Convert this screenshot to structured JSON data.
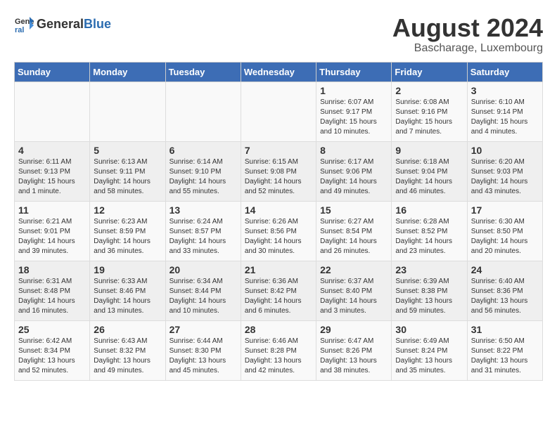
{
  "logo": {
    "text_general": "General",
    "text_blue": "Blue"
  },
  "title": "August 2024",
  "subtitle": "Bascharage, Luxembourg",
  "days_of_week": [
    "Sunday",
    "Monday",
    "Tuesday",
    "Wednesday",
    "Thursday",
    "Friday",
    "Saturday"
  ],
  "weeks": [
    [
      {
        "day": "",
        "info": ""
      },
      {
        "day": "",
        "info": ""
      },
      {
        "day": "",
        "info": ""
      },
      {
        "day": "",
        "info": ""
      },
      {
        "day": "1",
        "info": "Sunrise: 6:07 AM\nSunset: 9:17 PM\nDaylight: 15 hours\nand 10 minutes."
      },
      {
        "day": "2",
        "info": "Sunrise: 6:08 AM\nSunset: 9:16 PM\nDaylight: 15 hours\nand 7 minutes."
      },
      {
        "day": "3",
        "info": "Sunrise: 6:10 AM\nSunset: 9:14 PM\nDaylight: 15 hours\nand 4 minutes."
      }
    ],
    [
      {
        "day": "4",
        "info": "Sunrise: 6:11 AM\nSunset: 9:13 PM\nDaylight: 15 hours\nand 1 minute."
      },
      {
        "day": "5",
        "info": "Sunrise: 6:13 AM\nSunset: 9:11 PM\nDaylight: 14 hours\nand 58 minutes."
      },
      {
        "day": "6",
        "info": "Sunrise: 6:14 AM\nSunset: 9:10 PM\nDaylight: 14 hours\nand 55 minutes."
      },
      {
        "day": "7",
        "info": "Sunrise: 6:15 AM\nSunset: 9:08 PM\nDaylight: 14 hours\nand 52 minutes."
      },
      {
        "day": "8",
        "info": "Sunrise: 6:17 AM\nSunset: 9:06 PM\nDaylight: 14 hours\nand 49 minutes."
      },
      {
        "day": "9",
        "info": "Sunrise: 6:18 AM\nSunset: 9:04 PM\nDaylight: 14 hours\nand 46 minutes."
      },
      {
        "day": "10",
        "info": "Sunrise: 6:20 AM\nSunset: 9:03 PM\nDaylight: 14 hours\nand 43 minutes."
      }
    ],
    [
      {
        "day": "11",
        "info": "Sunrise: 6:21 AM\nSunset: 9:01 PM\nDaylight: 14 hours\nand 39 minutes."
      },
      {
        "day": "12",
        "info": "Sunrise: 6:23 AM\nSunset: 8:59 PM\nDaylight: 14 hours\nand 36 minutes."
      },
      {
        "day": "13",
        "info": "Sunrise: 6:24 AM\nSunset: 8:57 PM\nDaylight: 14 hours\nand 33 minutes."
      },
      {
        "day": "14",
        "info": "Sunrise: 6:26 AM\nSunset: 8:56 PM\nDaylight: 14 hours\nand 30 minutes."
      },
      {
        "day": "15",
        "info": "Sunrise: 6:27 AM\nSunset: 8:54 PM\nDaylight: 14 hours\nand 26 minutes."
      },
      {
        "day": "16",
        "info": "Sunrise: 6:28 AM\nSunset: 8:52 PM\nDaylight: 14 hours\nand 23 minutes."
      },
      {
        "day": "17",
        "info": "Sunrise: 6:30 AM\nSunset: 8:50 PM\nDaylight: 14 hours\nand 20 minutes."
      }
    ],
    [
      {
        "day": "18",
        "info": "Sunrise: 6:31 AM\nSunset: 8:48 PM\nDaylight: 14 hours\nand 16 minutes."
      },
      {
        "day": "19",
        "info": "Sunrise: 6:33 AM\nSunset: 8:46 PM\nDaylight: 14 hours\nand 13 minutes."
      },
      {
        "day": "20",
        "info": "Sunrise: 6:34 AM\nSunset: 8:44 PM\nDaylight: 14 hours\nand 10 minutes."
      },
      {
        "day": "21",
        "info": "Sunrise: 6:36 AM\nSunset: 8:42 PM\nDaylight: 14 hours\nand 6 minutes."
      },
      {
        "day": "22",
        "info": "Sunrise: 6:37 AM\nSunset: 8:40 PM\nDaylight: 14 hours\nand 3 minutes."
      },
      {
        "day": "23",
        "info": "Sunrise: 6:39 AM\nSunset: 8:38 PM\nDaylight: 13 hours\nand 59 minutes."
      },
      {
        "day": "24",
        "info": "Sunrise: 6:40 AM\nSunset: 8:36 PM\nDaylight: 13 hours\nand 56 minutes."
      }
    ],
    [
      {
        "day": "25",
        "info": "Sunrise: 6:42 AM\nSunset: 8:34 PM\nDaylight: 13 hours\nand 52 minutes."
      },
      {
        "day": "26",
        "info": "Sunrise: 6:43 AM\nSunset: 8:32 PM\nDaylight: 13 hours\nand 49 minutes."
      },
      {
        "day": "27",
        "info": "Sunrise: 6:44 AM\nSunset: 8:30 PM\nDaylight: 13 hours\nand 45 minutes."
      },
      {
        "day": "28",
        "info": "Sunrise: 6:46 AM\nSunset: 8:28 PM\nDaylight: 13 hours\nand 42 minutes."
      },
      {
        "day": "29",
        "info": "Sunrise: 6:47 AM\nSunset: 8:26 PM\nDaylight: 13 hours\nand 38 minutes."
      },
      {
        "day": "30",
        "info": "Sunrise: 6:49 AM\nSunset: 8:24 PM\nDaylight: 13 hours\nand 35 minutes."
      },
      {
        "day": "31",
        "info": "Sunrise: 6:50 AM\nSunset: 8:22 PM\nDaylight: 13 hours\nand 31 minutes."
      }
    ]
  ]
}
